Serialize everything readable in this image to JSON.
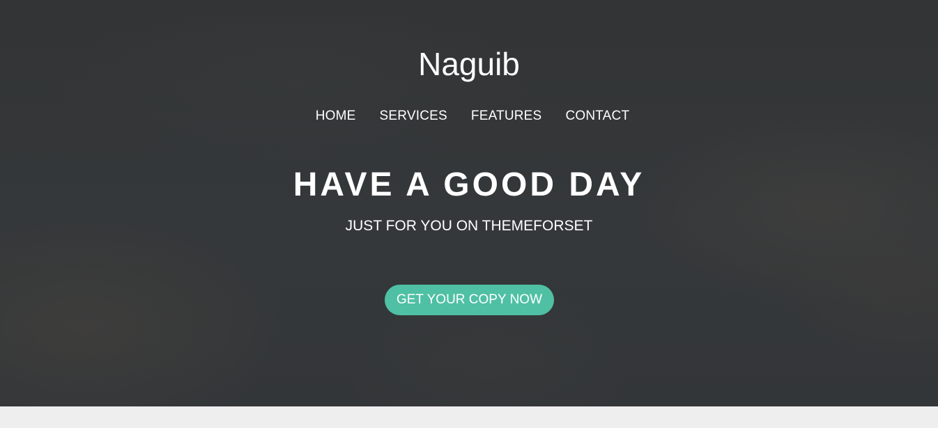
{
  "site": {
    "brand": "Naguib"
  },
  "nav": {
    "items": [
      {
        "label": "HOME"
      },
      {
        "label": "SERVICES"
      },
      {
        "label": "FEATURES"
      },
      {
        "label": "CONTACT"
      }
    ]
  },
  "hero": {
    "headline": "HAVE A GOOD DAY",
    "subline": "JUST FOR YOU ON THEMEFORSET",
    "cta_label": "GET YOUR COPY NOW"
  },
  "colors": {
    "accent": "#4fc0a4",
    "hero_overlay": "#333638",
    "page_background": "#eeeeee",
    "text": "#ffffff"
  }
}
